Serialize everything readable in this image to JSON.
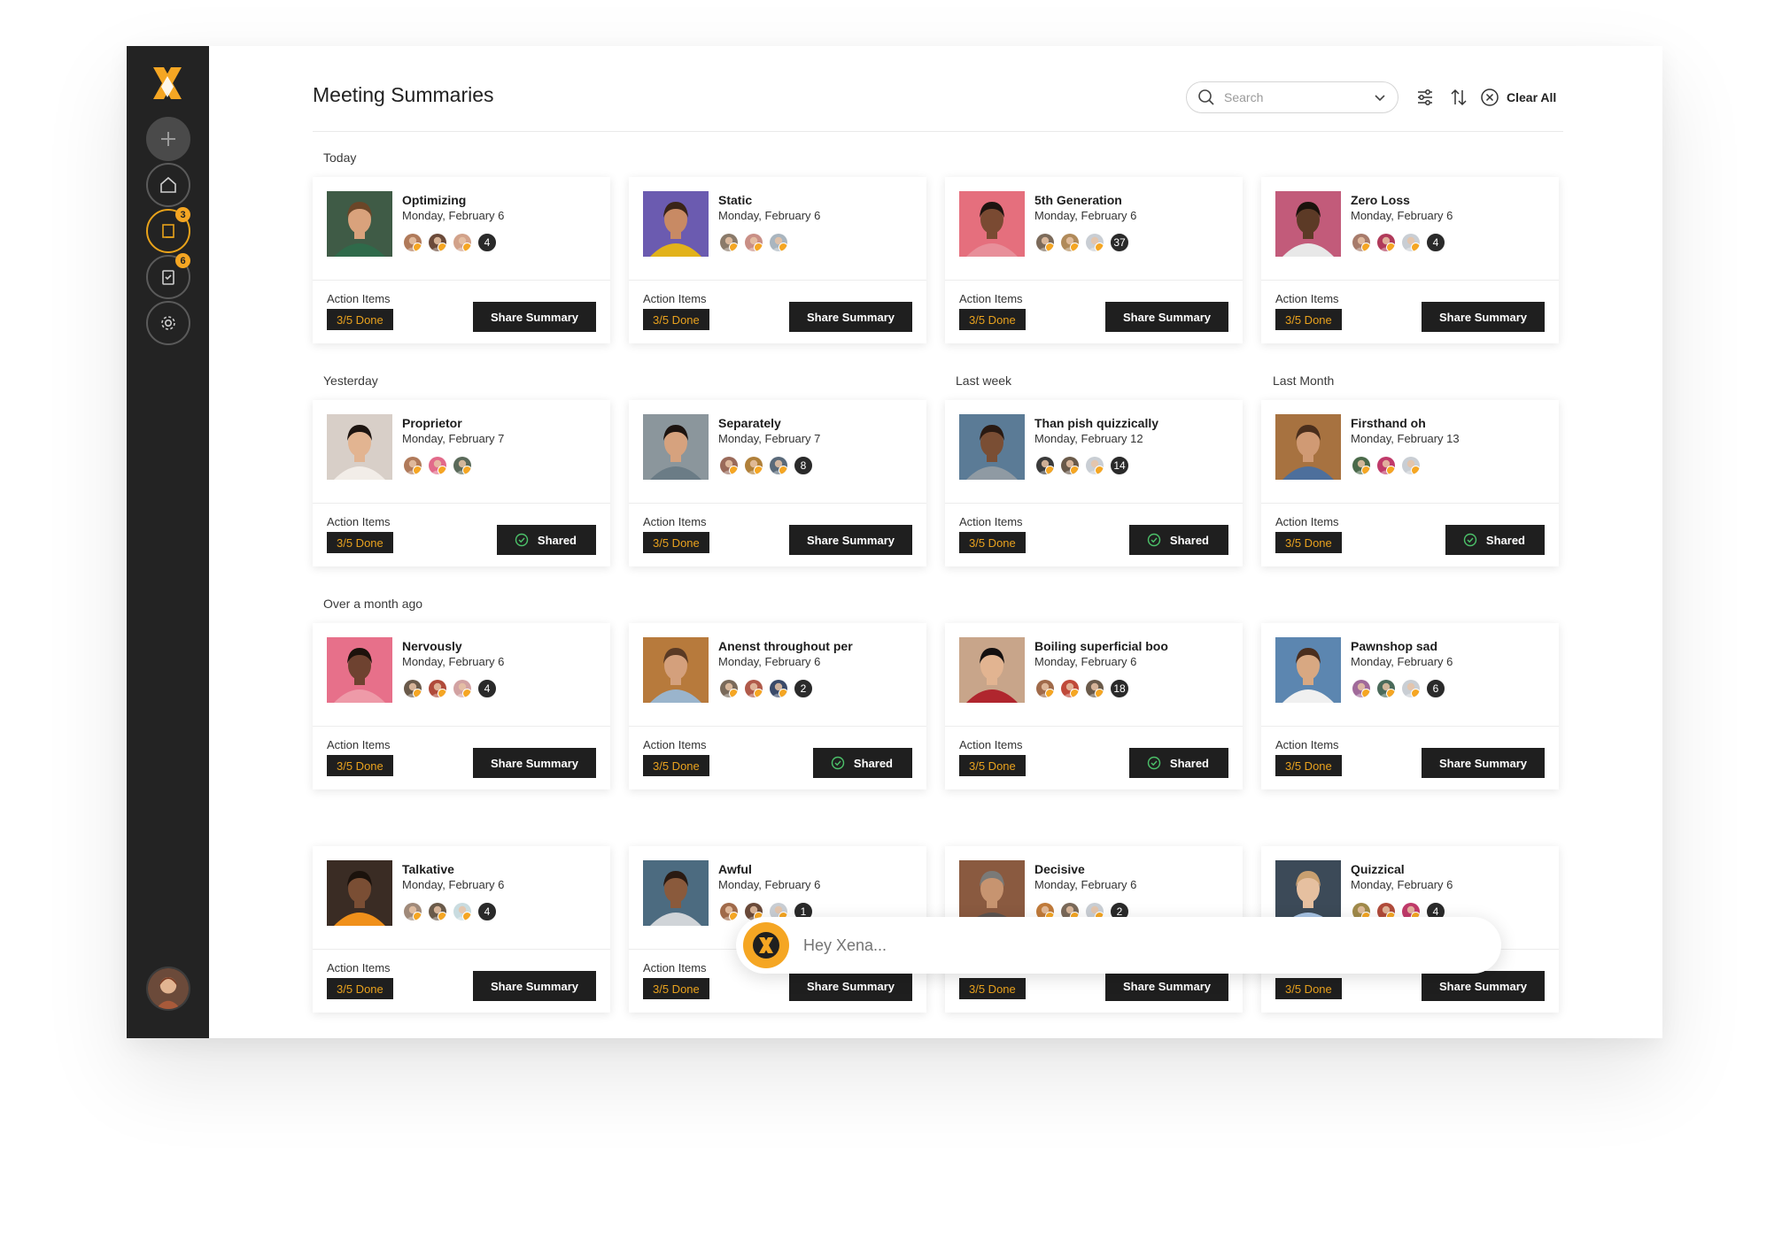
{
  "header": {
    "title": "Meeting Summaries",
    "search_placeholder": "Search",
    "clear_all": "Clear All"
  },
  "sidebar": {
    "badges": {
      "notes": "3",
      "tasks": "6"
    }
  },
  "labels": {
    "action_items": "Action Items",
    "share_summary": "Share Summary",
    "shared": "Shared"
  },
  "sections": {
    "today": "Today",
    "yesterday": "Yesterday",
    "last_week": "Last week",
    "last_month": "Last Month",
    "over_month": "Over a month ago"
  },
  "cards": [
    {
      "title": "Optimizing",
      "date": "Monday, February 6",
      "count": "4",
      "progress": "3/5 Done",
      "shared": false,
      "avatars": [
        "#b07a5a",
        "#6b4a3a",
        "#d2a28a"
      ],
      "photo": {
        "bg": "#3f5b46",
        "skin": "#d9a27c",
        "hair": "#6b4628",
        "shirt": "#2f6a4a"
      }
    },
    {
      "title": "Static",
      "date": "Monday, February 6",
      "count": "",
      "progress": "3/5 Done",
      "shared": false,
      "avatars": [
        "#8a7a6a",
        "#c98f86",
        "#a9b5bf"
      ],
      "photo": {
        "bg": "#6b5bb0",
        "skin": "#c88a64",
        "hair": "#3a2418",
        "shirt": "#e2b21a"
      }
    },
    {
      "title": "5th Generation",
      "date": "Monday, February 6",
      "count": "37",
      "progress": "3/5 Done",
      "shared": false,
      "avatars": [
        "#7b6a5a",
        "#b08a5a",
        "#c9ced4"
      ],
      "photo": {
        "bg": "#e56f7d",
        "skin": "#7a4a32",
        "hair": "#1e1410",
        "shirt": "#e88f9a"
      }
    },
    {
      "title": "Zero Loss",
      "date": "Monday, February 6",
      "count": "4",
      "progress": "3/5 Done",
      "shared": false,
      "avatars": [
        "#a77b6b",
        "#b03a5a",
        "#c9ced4"
      ],
      "photo": {
        "bg": "#c25b7a",
        "skin": "#5c3a26",
        "hair": "#1b120c",
        "shirt": "#e8e8e8"
      }
    },
    {
      "title": "Proprietor",
      "date": "Monday, February 7",
      "count": "",
      "progress": "3/5 Done",
      "shared": true,
      "avatars": [
        "#b07a5a",
        "#e26a8a",
        "#5a6a5a"
      ],
      "photo": {
        "bg": "#d8cfc8",
        "skin": "#e2b491",
        "hair": "#1d1410",
        "shirt": "#f2ede8"
      }
    },
    {
      "title": "Separately",
      "date": "Monday, February 7",
      "count": "8",
      "progress": "3/5 Done",
      "shared": false,
      "avatars": [
        "#9a6a5a",
        "#b0803a",
        "#5a6a7a"
      ],
      "photo": {
        "bg": "#8b969c",
        "skin": "#d6a27e",
        "hair": "#1d1410",
        "shirt": "#6b7c86"
      }
    },
    {
      "title": "Than pish quizzically",
      "date": "Monday, February 12",
      "count": "14",
      "progress": "3/5 Done",
      "shared": true,
      "avatars": [
        "#3a3a3a",
        "#6a5a4a",
        "#c9ced4"
      ],
      "photo": {
        "bg": "#5b7b96",
        "skin": "#7a4e34",
        "hair": "#2a1a12",
        "shirt": "#8f9aa3"
      }
    },
    {
      "title": "Firsthand oh",
      "date": "Monday, February 13",
      "count": "",
      "progress": "3/5 Done",
      "shared": true,
      "avatars": [
        "#4a6a4a",
        "#c03a6a",
        "#c9ced4"
      ],
      "photo": {
        "bg": "#a77240",
        "skin": "#d09a74",
        "hair": "#4a2e1c",
        "shirt": "#4d6f9c"
      }
    },
    {
      "title": "Nervously",
      "date": "Monday, February 6",
      "count": "4",
      "progress": "3/5 Done",
      "shared": false,
      "avatars": [
        "#6a5a4a",
        "#b04a3a",
        "#d2a2a2"
      ],
      "photo": {
        "bg": "#e7708a",
        "skin": "#6e4230",
        "hair": "#1d120c",
        "shirt": "#ee9aa8"
      }
    },
    {
      "title": "Anenst throughout per",
      "date": "Monday, February 6",
      "count": "2",
      "progress": "3/5 Done",
      "shared": true,
      "avatars": [
        "#7a6a5a",
        "#b05a4a",
        "#3a4a6a"
      ],
      "photo": {
        "bg": "#b77a3c",
        "skin": "#d4a07c",
        "hair": "#5a3a24",
        "shirt": "#9ab4cc"
      }
    },
    {
      "title": "Boiling superficial boo",
      "date": "Monday, February 6",
      "count": "18",
      "progress": "3/5 Done",
      "shared": true,
      "avatars": [
        "#a06a4a",
        "#c04a3a",
        "#6a5a4a"
      ],
      "photo": {
        "bg": "#c8a58a",
        "skin": "#e2b491",
        "hair": "#141010",
        "shirt": "#b0262e"
      }
    },
    {
      "title": "Pawnshop sad",
      "date": "Monday, February 6",
      "count": "6",
      "progress": "3/5 Done",
      "shared": false,
      "avatars": [
        "#a06a9a",
        "#4a6a5a",
        "#c9ced4"
      ],
      "photo": {
        "bg": "#5c86b0",
        "skin": "#d8a882",
        "hair": "#4a2e1e",
        "shirt": "#f0f0f0"
      }
    },
    {
      "title": "Talkative",
      "date": "Monday, February 6",
      "count": "4",
      "progress": "3/5 Done",
      "shared": false,
      "avatars": [
        "#a08a7a",
        "#6a5a4a",
        "#c9dce0"
      ],
      "photo": {
        "bg": "#3a2c24",
        "skin": "#7a4e34",
        "hair": "#1b120c",
        "shirt": "#f0901a"
      }
    },
    {
      "title": "Awful",
      "date": "Monday, February 6",
      "count": "1",
      "progress": "3/5 Done",
      "shared": false,
      "avatars": [
        "#a06a4a",
        "#6a4a3a",
        "#c9ced4"
      ],
      "photo": {
        "bg": "#4c6b80",
        "skin": "#8a5a3c",
        "hair": "#2a1a12",
        "shirt": "#d0d4d8"
      }
    },
    {
      "title": "Decisive",
      "date": "Monday, February 6",
      "count": "2",
      "progress": "3/5 Done",
      "shared": false,
      "avatars": [
        "#c07a3a",
        "#7a6a5a",
        "#c9ced4"
      ],
      "photo": {
        "bg": "#8a5a40",
        "skin": "#c79470",
        "hair": "#7a7a78",
        "shirt": "#5c5450"
      }
    },
    {
      "title": "Quizzical",
      "date": "Monday, February 6",
      "count": "4",
      "progress": "3/5 Done",
      "shared": false,
      "avatars": [
        "#a08a4a",
        "#b04a3a",
        "#c03a6a"
      ],
      "photo": {
        "bg": "#3c4a58",
        "skin": "#e6c0a0",
        "hair": "#c9a070",
        "shirt": "#a8c4e4"
      }
    }
  ],
  "chat": {
    "placeholder": "Hey Xena..."
  },
  "colors": {
    "accent": "#f5a623",
    "sidebar": "#232323",
    "button": "#1f1f1f",
    "progress_text": "#e9a21e"
  }
}
